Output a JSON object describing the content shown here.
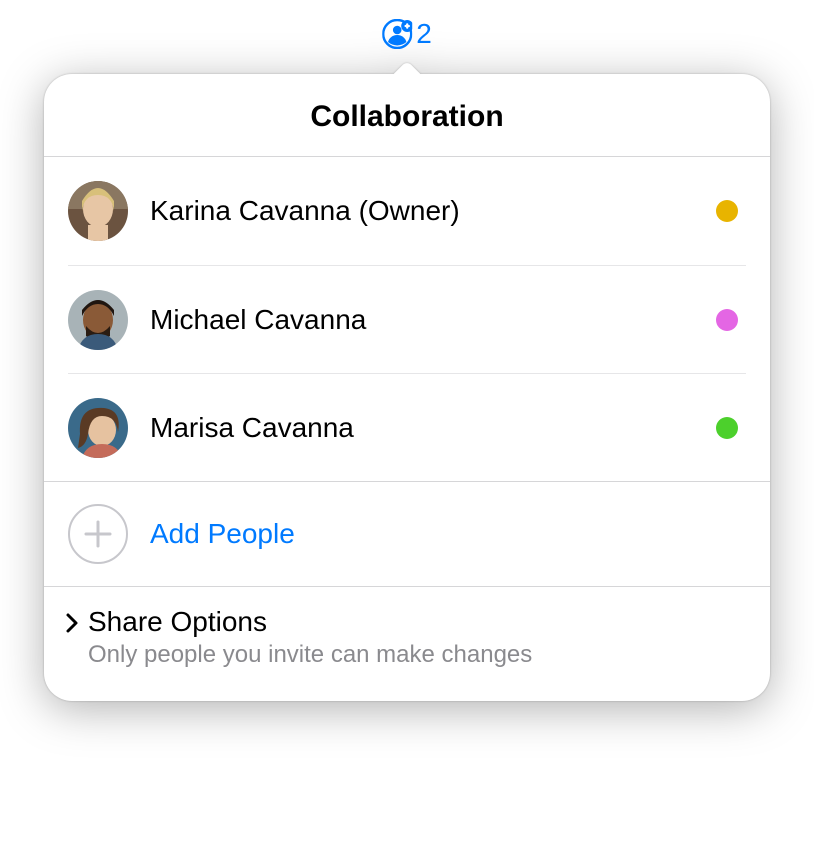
{
  "trigger": {
    "count": "2"
  },
  "header": {
    "title": "Collaboration"
  },
  "participants": [
    {
      "name": "Karina Cavanna (Owner)",
      "dot_color": "#e8b400"
    },
    {
      "name": "Michael Cavanna",
      "dot_color": "#e466e4"
    },
    {
      "name": "Marisa Cavanna",
      "dot_color": "#4cd02c"
    }
  ],
  "add": {
    "label": "Add People"
  },
  "share": {
    "title": "Share Options",
    "subtitle": "Only people you invite can make changes"
  },
  "colors": {
    "accent": "#007aff"
  }
}
